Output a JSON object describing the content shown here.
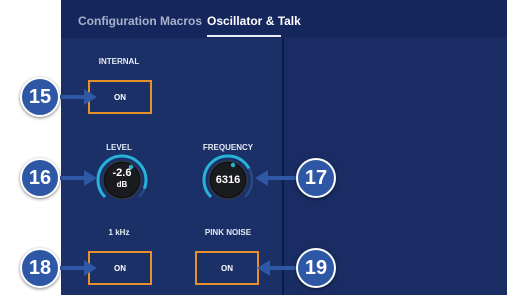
{
  "tabs": [
    {
      "label": "Configuration Macros",
      "active": false
    },
    {
      "label": "Oscillator & Talk",
      "active": true
    }
  ],
  "oscillator": {
    "internal_label": "INTERNAL",
    "internal_button": "ON",
    "level_label": "LEVEL",
    "level_value": "-2.6",
    "level_unit": "dB",
    "frequency_label": "FREQUENCY",
    "frequency_value": "6316",
    "khz_label": "1 kHz",
    "khz_button": "ON",
    "pink_noise_label": "PINK NOISE",
    "pink_noise_button": "ON"
  },
  "callouts": [
    "15",
    "16",
    "17",
    "18",
    "19"
  ],
  "colors": {
    "panel": "#1b3066",
    "button_border": "#e8912b",
    "knob_arc": "#27b3d8",
    "callout": "#2e58a6"
  }
}
